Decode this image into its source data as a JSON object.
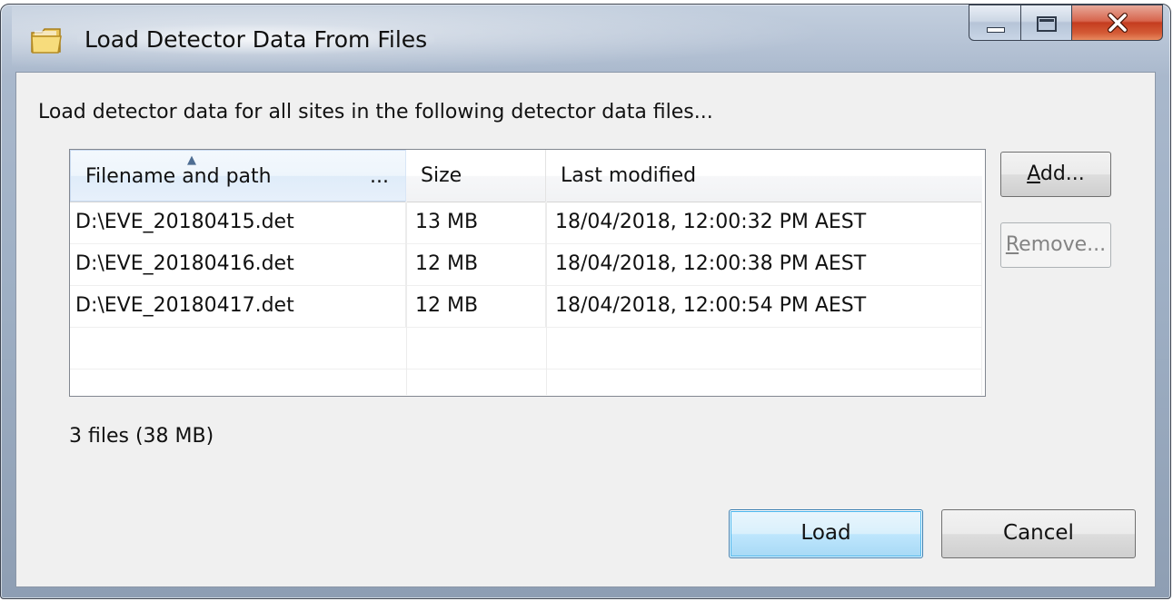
{
  "window": {
    "title": "Load Detector Data From Files",
    "icon": "folder-icon"
  },
  "caption_buttons": {
    "minimize": "minimize-icon",
    "maximize": "maximize-icon",
    "close": "close-icon"
  },
  "instruction": "Load detector data for all sites in the following detector data files...",
  "table": {
    "columns": [
      {
        "label": "Filename and path",
        "extra": "...",
        "sorted": "ascending"
      },
      {
        "label": "Size"
      },
      {
        "label": "Last modified"
      }
    ],
    "rows": [
      {
        "filename": "D:\\EVE_20180415.det",
        "size": "13 MB",
        "modified": "18/04/2018, 12:00:32 PM AEST"
      },
      {
        "filename": "D:\\EVE_20180416.det",
        "size": "12 MB",
        "modified": "18/04/2018, 12:00:38 PM AEST"
      },
      {
        "filename": "D:\\EVE_20180417.det",
        "size": "12 MB",
        "modified": "18/04/2018, 12:00:54 PM AEST"
      }
    ]
  },
  "side_buttons": {
    "add": {
      "mnemonic": "A",
      "rest": "dd..."
    },
    "remove": {
      "mnemonic": "R",
      "rest": "emove...",
      "enabled": false
    }
  },
  "summary": "3 files (38 MB)",
  "footer": {
    "load": "Load",
    "cancel": "Cancel"
  },
  "colors": {
    "close_button": "#c43c1f",
    "default_button_border": "#3c7fb1",
    "client_background": "#f0f0f0"
  }
}
